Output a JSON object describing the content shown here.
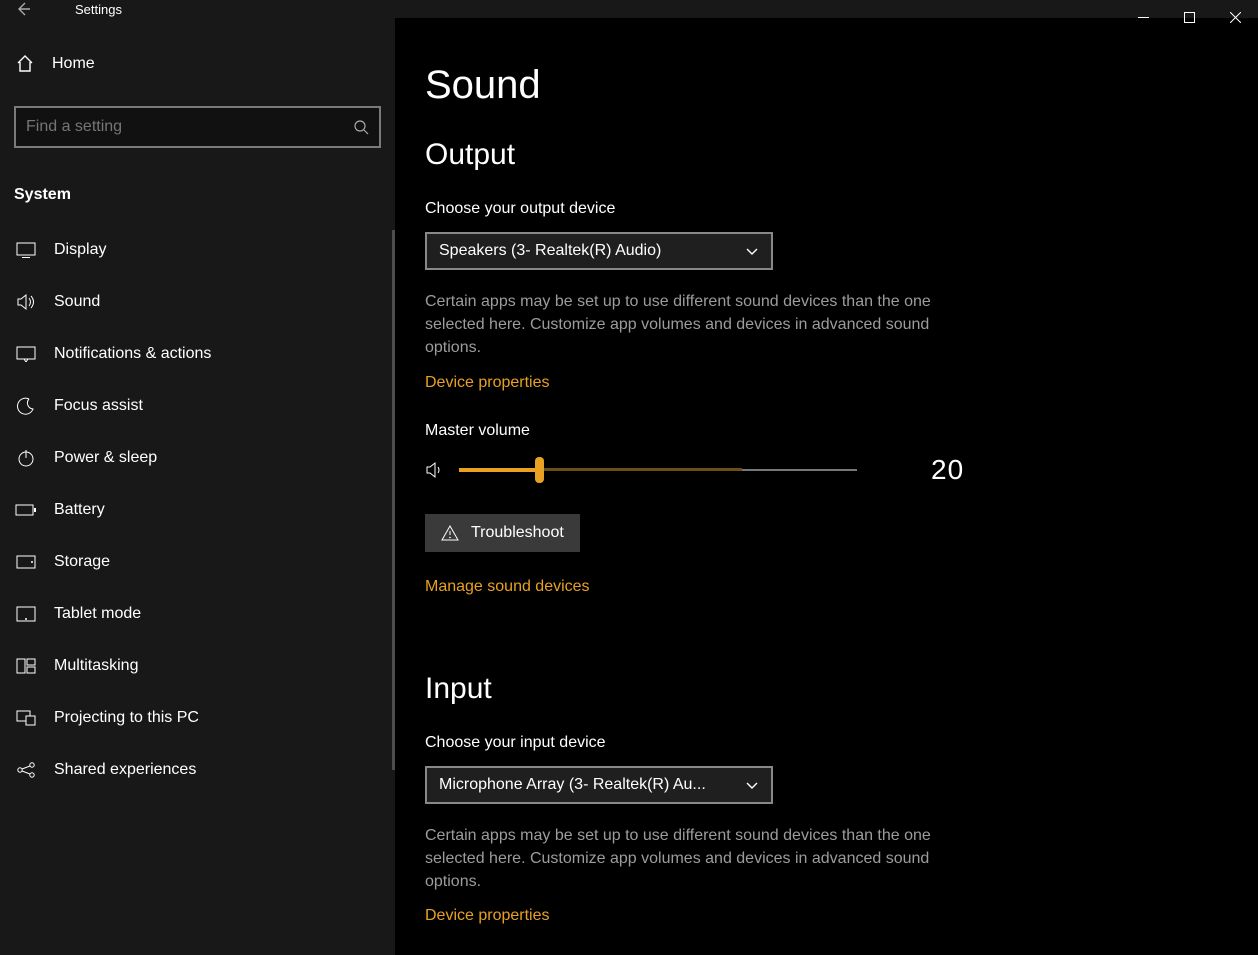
{
  "titlebar": {
    "title": "Settings"
  },
  "sidebar": {
    "home_label": "Home",
    "search_placeholder": "Find a setting",
    "category": "System",
    "items": [
      {
        "label": "Display",
        "icon": "display"
      },
      {
        "label": "Sound",
        "icon": "sound"
      },
      {
        "label": "Notifications & actions",
        "icon": "notifications"
      },
      {
        "label": "Focus assist",
        "icon": "moon"
      },
      {
        "label": "Power & sleep",
        "icon": "power"
      },
      {
        "label": "Battery",
        "icon": "battery"
      },
      {
        "label": "Storage",
        "icon": "storage"
      },
      {
        "label": "Tablet mode",
        "icon": "tablet"
      },
      {
        "label": "Multitasking",
        "icon": "multitask"
      },
      {
        "label": "Projecting to this PC",
        "icon": "project"
      },
      {
        "label": "Shared experiences",
        "icon": "shared"
      }
    ]
  },
  "main": {
    "page_title": "Sound",
    "output": {
      "heading": "Output",
      "choose_label": "Choose your output device",
      "device": "Speakers (3- Realtek(R) Audio)",
      "note": "Certain apps may be set up to use different sound devices than the one selected here. Customize app volumes and devices in advanced sound options.",
      "device_props_link": "Device properties",
      "volume_label": "Master volume",
      "volume_value": 20,
      "volume_buffer_end": 71,
      "troubleshoot_label": "Troubleshoot",
      "manage_link": "Manage sound devices"
    },
    "input": {
      "heading": "Input",
      "choose_label": "Choose your input device",
      "device": "Microphone Array (3- Realtek(R) Au...",
      "note": "Certain apps may be set up to use different sound devices than the one selected here. Customize app volumes and devices in advanced sound options.",
      "device_props_link": "Device properties"
    }
  },
  "colors": {
    "accent": "#e8a122"
  }
}
